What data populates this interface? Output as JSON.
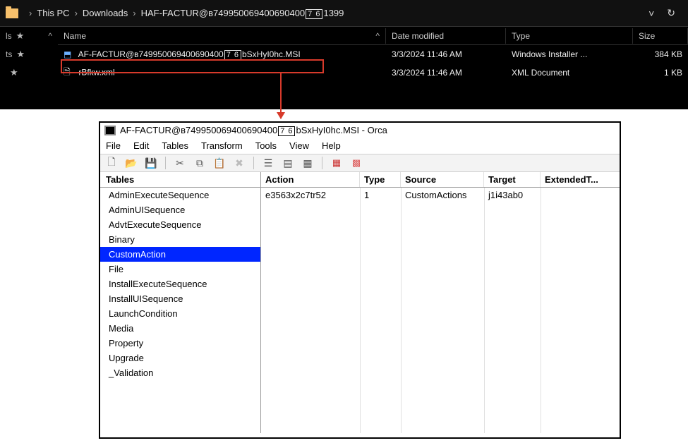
{
  "explorer": {
    "breadcrumbs": [
      "This PC",
      "Downloads",
      "HAF-FACTUR@в749950069400690400"
    ],
    "bc_box": "7 6",
    "bc_tail": "1399",
    "columns": [
      "Name",
      "Date modified",
      "Type",
      "Size"
    ],
    "left_pins": [
      {
        "label": "ls",
        "icon": "★"
      },
      {
        "label": "ts",
        "icon": "★"
      },
      {
        "label": "",
        "icon": "★"
      }
    ],
    "rows": [
      {
        "name_pre": "AF-FACTUR@в749950069400690400",
        "name_box": "7 6",
        "name_post": "bSxHyI0hc.MSI",
        "date": "3/3/2024 11:46 AM",
        "type": "Windows Installer ...",
        "size": "384 KB",
        "icon": "msi"
      },
      {
        "name_pre": "rBfkw.xml",
        "name_box": "",
        "name_post": "",
        "date": "3/3/2024 11:46 AM",
        "type": "XML Document",
        "size": "1 KB",
        "icon": "xml"
      }
    ]
  },
  "orca": {
    "title_pre": "AF-FACTUR@в749950069400690400",
    "title_box": "7 6",
    "title_post": "bSxHyI0hc.MSI - Orca",
    "menu": [
      "File",
      "Edit",
      "Tables",
      "Transform",
      "Tools",
      "View",
      "Help"
    ],
    "tables_header": "Tables",
    "tables": [
      "AdminExecuteSequence",
      "AdminUISequence",
      "AdvtExecuteSequence",
      "Binary",
      "CustomAction",
      "File",
      "InstallExecuteSequence",
      "InstallUISequence",
      "LaunchCondition",
      "Media",
      "Property",
      "Upgrade",
      "_Validation"
    ],
    "selected_table": "CustomAction",
    "content_headers": [
      "Action",
      "Type",
      "Source",
      "Target",
      "ExtendedT..."
    ],
    "content_rows": [
      {
        "action": "e3563x2c7tr52",
        "type": "1",
        "source": "CustomActions",
        "target": "j1i43ab0",
        "ext": ""
      }
    ]
  }
}
